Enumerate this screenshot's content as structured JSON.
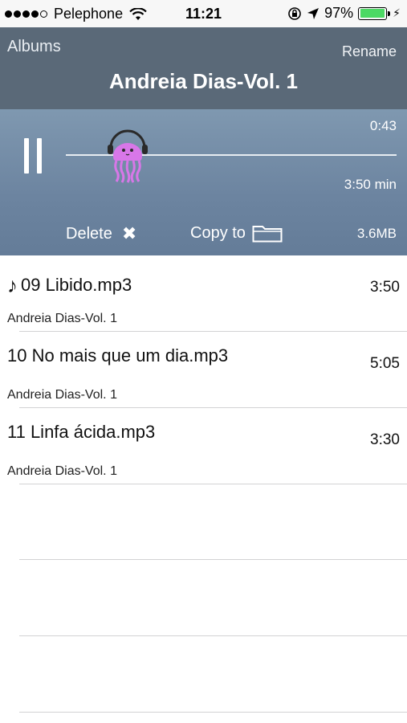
{
  "status_bar": {
    "carrier": "Pelephone",
    "time": "11:21",
    "battery_percent": "97%",
    "battery_level": 0.97,
    "signal_bars": 4,
    "signal_max": 5
  },
  "header": {
    "back_label": "Albums",
    "rename_label": "Rename",
    "title": "Andreia Dias-Vol. 1"
  },
  "player": {
    "elapsed": "0:43",
    "duration": "3:50 min",
    "progress": 0.187,
    "delete_label": "Delete",
    "copy_label": "Copy to",
    "size": "3.6MB",
    "icons": {
      "pause": "pause-icon",
      "delete": "close-icon",
      "copy": "folder-icon",
      "scrubber": "jellyfish-headphones-icon"
    },
    "colors": {
      "header_bg": "#5a6978",
      "player_bg": "#6c84a0",
      "scrubber_pink": "#d877e8"
    }
  },
  "tracks": [
    {
      "name": "09 Libido.mp3",
      "album": "Andreia Dias-Vol. 1",
      "time": "3:50",
      "playing": true
    },
    {
      "name": "10 No mais que um dia.mp3",
      "album": "Andreia Dias-Vol. 1",
      "time": "5:05",
      "playing": false
    },
    {
      "name": "11 Linfa ácida.mp3",
      "album": "Andreia Dias-Vol. 1",
      "time": "3:30",
      "playing": false
    }
  ]
}
